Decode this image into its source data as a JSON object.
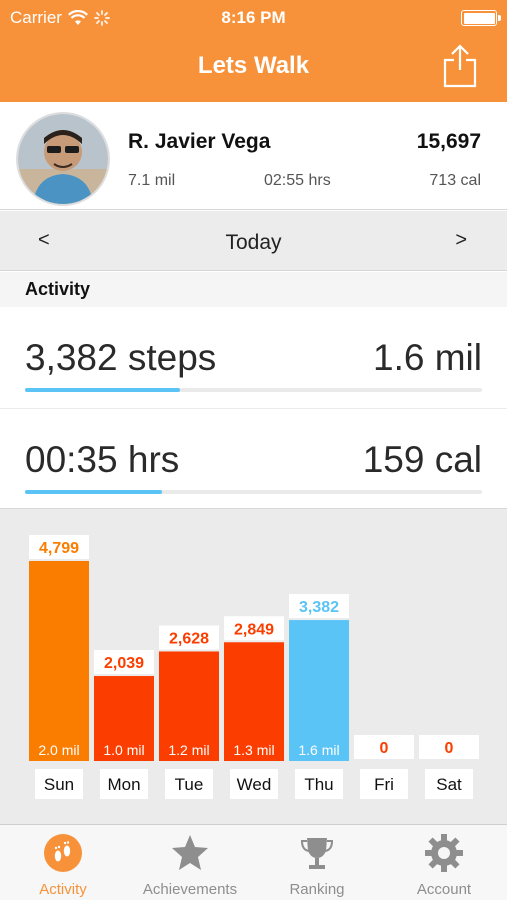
{
  "status_bar": {
    "carrier": "Carrier",
    "time": "8:16 PM"
  },
  "nav": {
    "title": "Lets Walk",
    "share_icon": "share-icon"
  },
  "profile": {
    "name": "R. Javier Vega",
    "total_steps": "15,697",
    "distance": "7.1 mil",
    "time": "02:55 hrs",
    "calories": "713 cal"
  },
  "day_selector": {
    "prev": "<",
    "label": "Today",
    "next": ">"
  },
  "section": {
    "title": "Activity"
  },
  "stats": {
    "steps": "3,382 steps",
    "distance": "1.6 mil",
    "steps_progress": 0.34,
    "duration": "00:35 hrs",
    "calories": "159 cal",
    "duration_progress": 0.3
  },
  "colors": {
    "accent": "#f7923a",
    "bar_red": "#fb3e00",
    "bar_orange": "#fb7d00",
    "bar_today": "#5ac4f6"
  },
  "chart_data": {
    "type": "bar",
    "categories": [
      "Sun",
      "Mon",
      "Tue",
      "Wed",
      "Thu",
      "Fri",
      "Sat"
    ],
    "values": [
      4799,
      2039,
      2628,
      2849,
      3382,
      0,
      0
    ],
    "value_labels": [
      "4,799",
      "2,039",
      "2,628",
      "2,849",
      "3,382",
      "0",
      "0"
    ],
    "distance_labels": [
      "2.0 mil",
      "1.0 mil",
      "1.2 mil",
      "1.3 mil",
      "1.6 mil",
      "",
      ""
    ],
    "highlight": "Thu",
    "ylim": [
      0,
      4799
    ]
  },
  "tabs": [
    {
      "label": "Activity",
      "icon": "footprints-icon",
      "active": true
    },
    {
      "label": "Achievements",
      "icon": "star-icon",
      "active": false
    },
    {
      "label": "Ranking",
      "icon": "trophy-icon",
      "active": false
    },
    {
      "label": "Account",
      "icon": "gear-icon",
      "active": false
    }
  ]
}
